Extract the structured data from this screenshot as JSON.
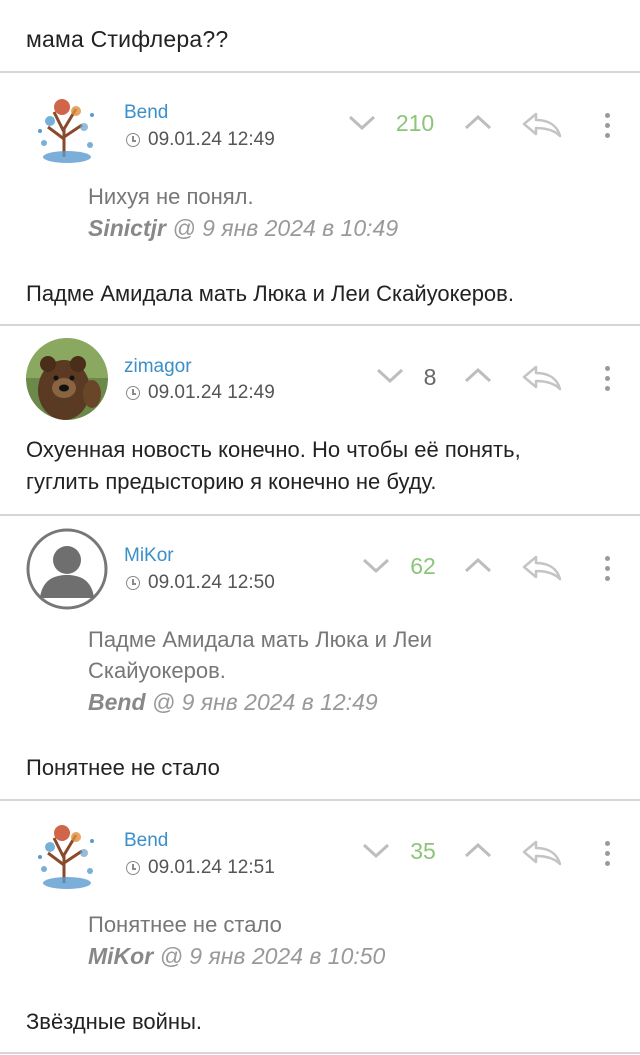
{
  "post_tail": "мама Стифлера??",
  "comments": [
    {
      "username": "Bend",
      "date": "09.01.24 12:49",
      "score": "210",
      "quote_lines": [
        "Нихуя не понял."
      ],
      "quote_author": "Sinictjr",
      "quote_when": "@ 9 янв 2024 в 10:49",
      "text_lines": [
        "Падме Амидала мать Люка и Леи Скайуокеров."
      ]
    },
    {
      "username": "zimagor",
      "date": "09.01.24 12:49",
      "score": "8",
      "text_lines": [
        "Охуенная новость конечно. Но чтобы её понять,",
        "гуглить предысторию я конечно не буду."
      ]
    },
    {
      "username": "MiKor",
      "date": "09.01.24 12:50",
      "score": "62",
      "quote_lines": [
        "Падме Амидала мать Люка и Леи",
        "Скайуокеров."
      ],
      "quote_author": "Bend",
      "quote_when": "@ 9 янв 2024 в 12:49",
      "text_lines": [
        "Понятнее не стало"
      ]
    },
    {
      "username": "Bend",
      "date": "09.01.24 12:51",
      "score": "35",
      "quote_lines": [
        "Понятнее не стало"
      ],
      "quote_author": "MiKor",
      "quote_when": "@ 9 янв 2024 в 10:50",
      "text_lines": [
        "Звёздные войны."
      ]
    }
  ],
  "colors": {
    "username": "#3a8fc9",
    "score_positive": "#8cc57a",
    "score_neutral": "#666666",
    "divider": "#d6d6d6"
  },
  "icons": [
    "downvote-chevron-icon",
    "upvote-chevron-icon",
    "reply-arrow-icon",
    "more-vertical-icon",
    "clock-icon"
  ]
}
